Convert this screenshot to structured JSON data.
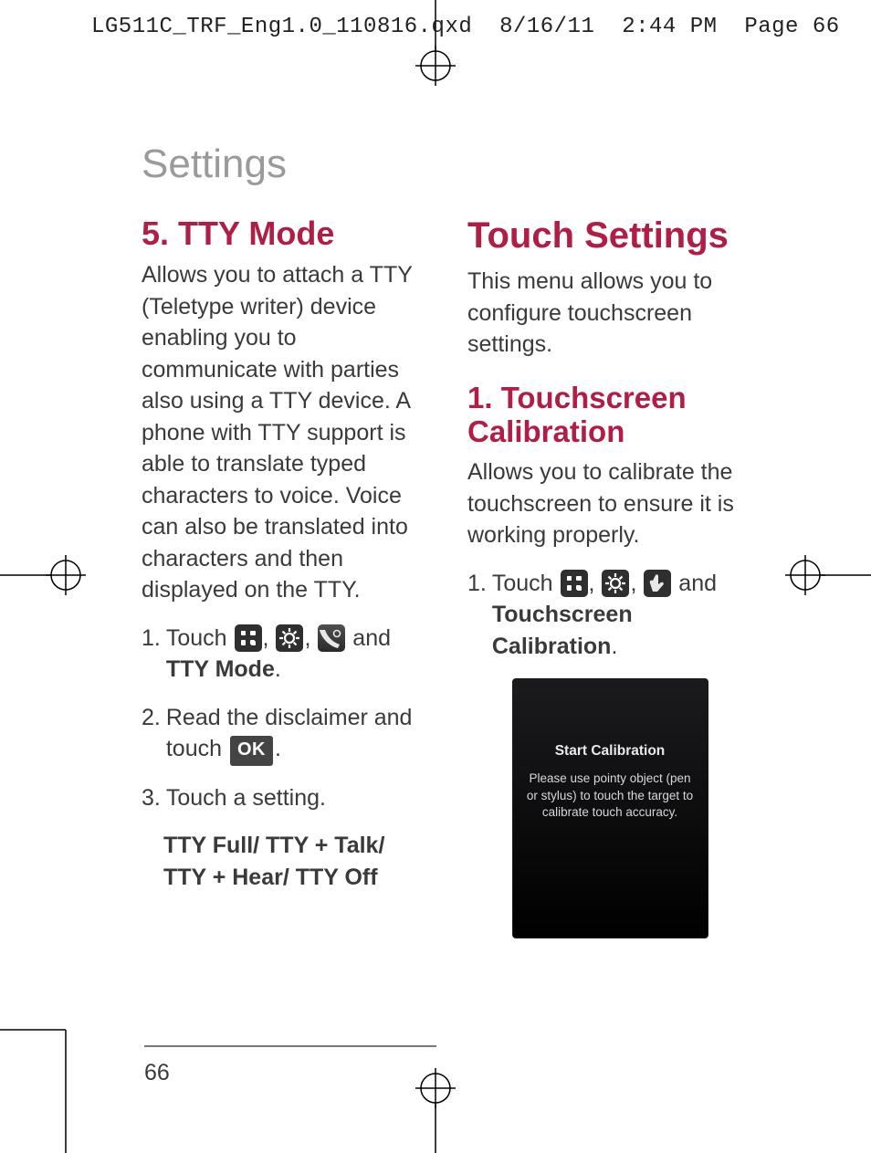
{
  "crop_header": "LG511C_TRF_Eng1.0_110816.qxd  8/16/11  2:44 PM  Page 66",
  "section_title": "Settings",
  "page_number": "66",
  "left": {
    "heading": "5. TTY Mode",
    "intro": "Allows you to attach a TTY (Teletype writer) device enabling you to communicate with parties also using a TTY device. A phone with TTY support is able to translate typed characters to voice. Voice can also be translated into characters and then displayed on the TTY.",
    "step1_pre": "Touch ",
    "step1_mid": " and ",
    "step1_bold": "TTY Mode",
    "step1_period": ".",
    "step2_pre": "Read the disclaimer and touch ",
    "step2_ok": "OK",
    "step2_period": ".",
    "step3": "Touch a setting.",
    "options": "TTY Full/ TTY + Talk/ TTY + Hear/ TTY Off"
  },
  "right": {
    "heading_big": "Touch Settings",
    "intro": "This menu allows you to configure touchscreen settings.",
    "heading2": "1. Touchscreen Calibration",
    "desc": "Allows you to calibrate the touchscreen to ensure it is working properly.",
    "step1_pre": "Touch ",
    "step1_mid": " and ",
    "step1_bold": "Touchscreen Calibration",
    "step1_period": ".",
    "phone_title": "Start Calibration",
    "phone_text": "Please use pointy object (pen or stylus) to touch the target to calibrate touch accuracy."
  }
}
